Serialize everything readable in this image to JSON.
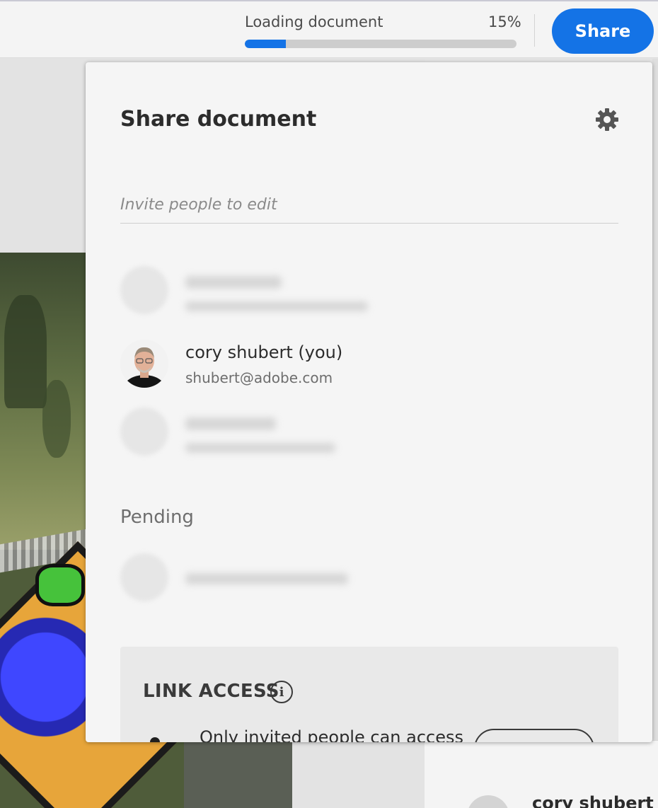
{
  "topbar": {
    "loading_label": "Loading document",
    "loading_percent_text": "15%",
    "loading_progress": 0.15,
    "share_button_label": "Share"
  },
  "colors": {
    "accent": "#1473e6",
    "panel_bg": "#f5f5f5",
    "text_primary": "#2c2c2c",
    "text_secondary": "#6e6e6e"
  },
  "dialog": {
    "title": "Share document",
    "settings_icon": "gear-icon",
    "invite_placeholder": "Invite people to edit",
    "members": [
      {
        "name": "",
        "email": "",
        "redacted": true
      },
      {
        "name": "cory shubert (you)",
        "email": "shubert@adobe.com",
        "redacted": false
      },
      {
        "name": "",
        "email": "",
        "redacted": true
      }
    ],
    "pending_label": "Pending",
    "pending": [
      {
        "email": "",
        "redacted": true
      }
    ],
    "link_access": {
      "title": "LINK ACCESS",
      "info_icon": "info-icon",
      "option_text": "Only invited people can access"
    }
  },
  "background_panel": {
    "user_name": "cory shubert"
  }
}
